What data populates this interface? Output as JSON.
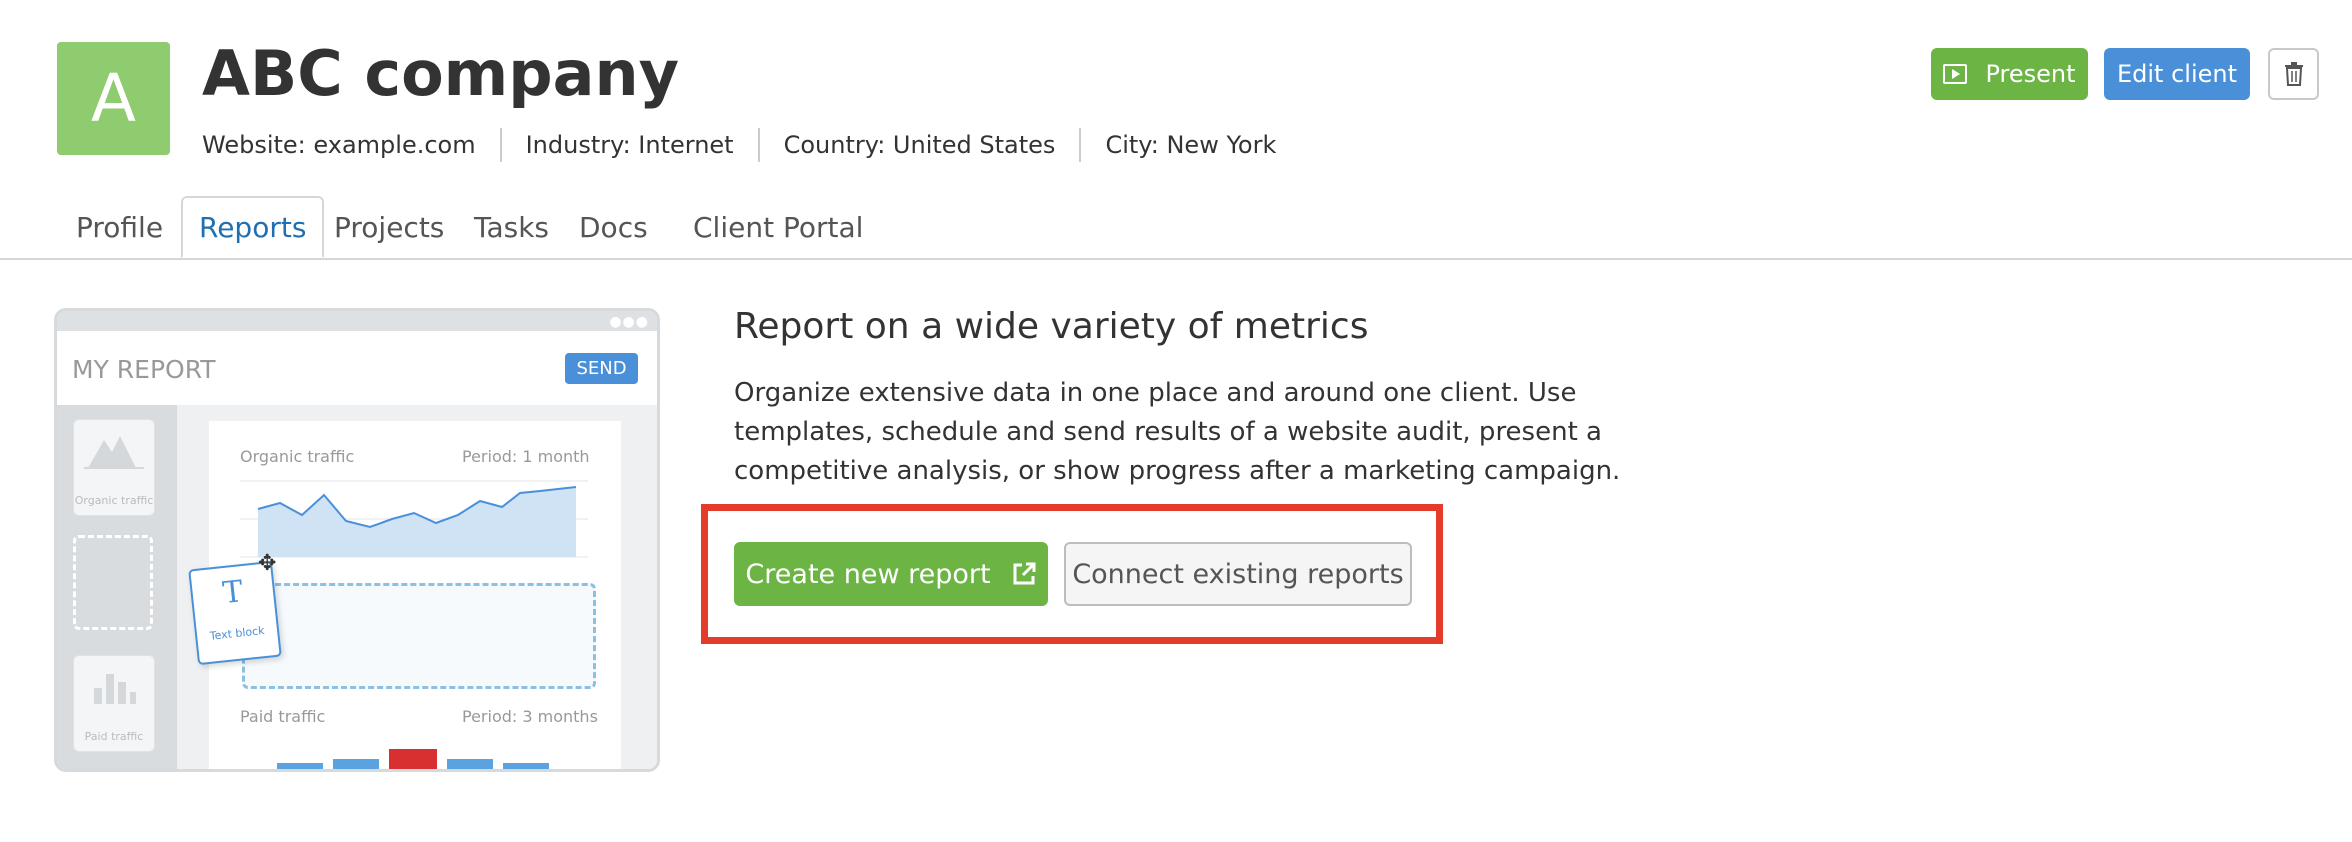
{
  "client": {
    "avatar_letter": "A",
    "name": "ABC company",
    "meta": [
      {
        "label": "Website:",
        "value": "example.com"
      },
      {
        "label": "Industry:",
        "value": "Internet"
      },
      {
        "label": "Country:",
        "value": "United States"
      },
      {
        "label": "City:",
        "value": "New York"
      }
    ]
  },
  "header_actions": {
    "present_label": "Present",
    "edit_label": "Edit client",
    "delete_icon": "trash-icon"
  },
  "tabs": [
    {
      "label": "Profile",
      "active": false
    },
    {
      "label": "Reports",
      "active": true
    },
    {
      "label": "Projects",
      "active": false
    },
    {
      "label": "Tasks",
      "active": false
    },
    {
      "label": "Docs",
      "active": false
    },
    {
      "label": "Client Portal",
      "active": false
    }
  ],
  "illustration": {
    "title": "MY REPORT",
    "send_label": "SEND",
    "tiles": [
      "Organic traffic",
      "Paid traffic"
    ],
    "organic_label": "Organic traffic",
    "organic_period": "Period: 1 month",
    "paid_label": "Paid traffic",
    "paid_period": "Period: 3 months",
    "text_block_letter": "T",
    "text_block_label": "Text block"
  },
  "promo": {
    "heading": "Report on a wide variety of metrics",
    "description": "Organize extensive data in one place and around one client. Use templates, schedule and send results of a website audit, present a competitive analysis, or show progress after a marketing campaign.",
    "create_label": "Create new report",
    "connect_label": "Connect existing reports"
  },
  "colors": {
    "green": "#6cb544",
    "blue": "#4a90d9",
    "highlight_red": "#e53b2b",
    "avatar": "#8fcb6f"
  }
}
